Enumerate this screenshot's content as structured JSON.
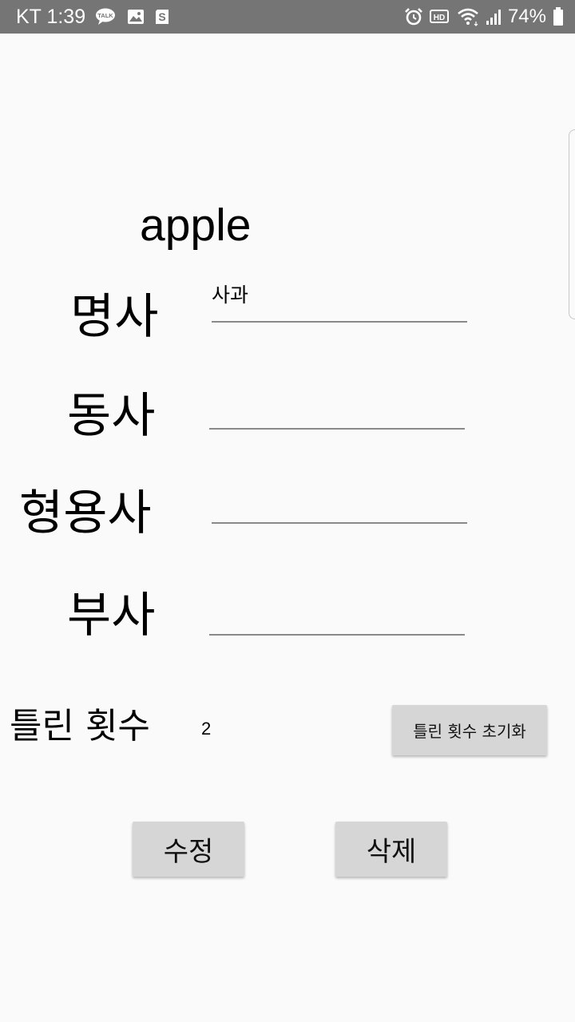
{
  "status_bar": {
    "carrier_time": "KT 1:39",
    "battery": "74%",
    "left_icons": [
      "talk-icon",
      "image-icon",
      "s-app-icon"
    ],
    "right_icons": [
      "alarm-icon",
      "hd-icon",
      "wifi-icon",
      "signal-icon",
      "battery-icon"
    ],
    "talk_badge": "TALK",
    "hd_badge": "HD"
  },
  "word": "apple",
  "fields": {
    "noun": {
      "label": "명사",
      "value": "사과"
    },
    "verb": {
      "label": "동사",
      "value": ""
    },
    "adjective": {
      "label": "형용사",
      "value": ""
    },
    "adverb": {
      "label": "부사",
      "value": ""
    }
  },
  "wrong_count": {
    "label": "틀린 횟수",
    "value": "2",
    "reset_label": "틀린 횟수 초기화"
  },
  "actions": {
    "edit_label": "수정",
    "delete_label": "삭제"
  },
  "colors": {
    "status_bar_bg": "#757575",
    "background": "#fafafa",
    "button_bg": "#d6d6d6",
    "underline": "#8a8a8a"
  }
}
